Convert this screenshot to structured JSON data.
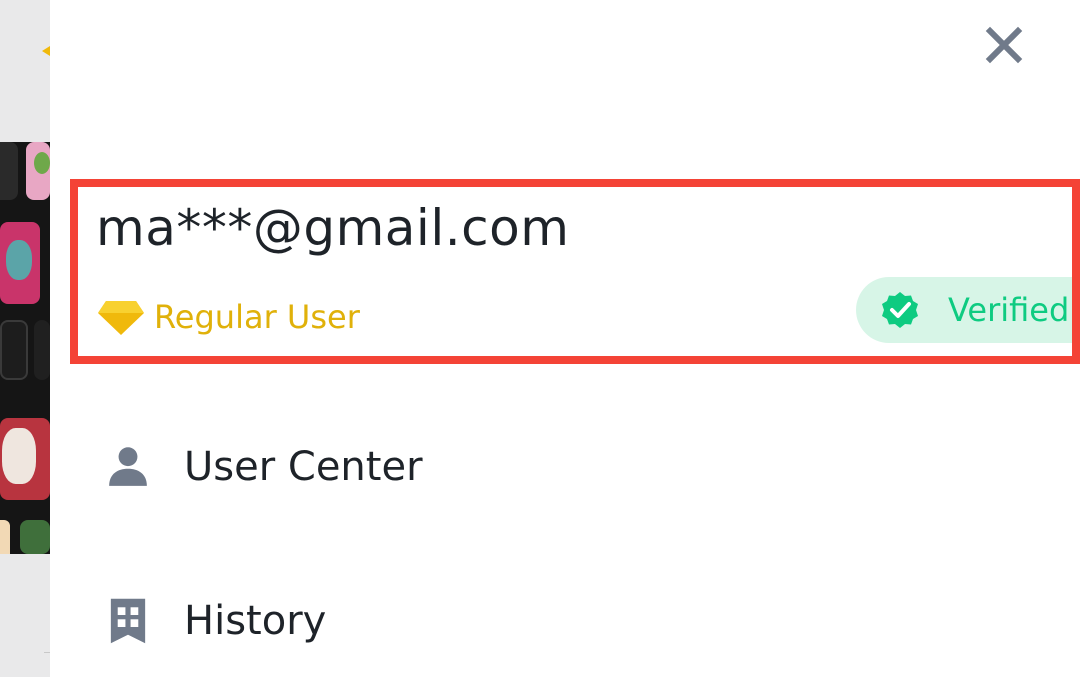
{
  "window": {
    "close_icon": "close-icon"
  },
  "account": {
    "email": "ma***@gmail.com",
    "tier": {
      "icon": "diamond-icon",
      "label": "Regular User",
      "color": "#e0b10a"
    },
    "verification": {
      "icon": "verified-check-icon",
      "label": "Verified",
      "color": "#0ecb81",
      "background": "#d7f5e7"
    },
    "highlight_color": "#f44336"
  },
  "menu": {
    "items": [
      {
        "icon": "user-icon",
        "label": "User Center"
      },
      {
        "icon": "history-icon",
        "label": "History"
      }
    ]
  }
}
